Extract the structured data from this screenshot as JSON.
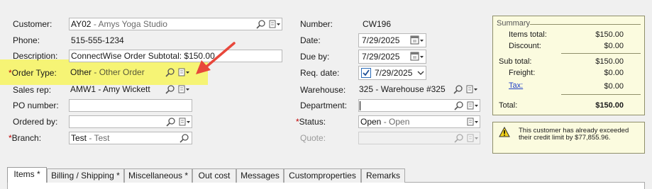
{
  "left": {
    "customer": {
      "label": "Customer:",
      "code": "AY02",
      "desc": "- Amys Yoga Studio"
    },
    "phone": {
      "label": "Phone:",
      "value": "515-555-1234"
    },
    "description": {
      "label": "Description:",
      "value": "ConnectWise Order Subtotal: $150.00"
    },
    "order_type": {
      "required": "*",
      "label": "Order Type:",
      "code": "Other",
      "desc": "- Other Order"
    },
    "sales_rep": {
      "label": "Sales rep:",
      "code": "AMW1",
      "desc": "- Amy Wickett"
    },
    "po_number": {
      "label": "PO number:",
      "value": ""
    },
    "ordered_by": {
      "label": "Ordered by:",
      "value": ""
    },
    "branch": {
      "required": "*",
      "label": "Branch:",
      "code": "Test",
      "desc": "- Test"
    }
  },
  "middle": {
    "number": {
      "label": "Number:",
      "value": "CW196"
    },
    "date": {
      "label": "Date:",
      "value": "7/29/2025"
    },
    "due_by": {
      "label": "Due by:",
      "value": "7/29/2025"
    },
    "req_date": {
      "label": "Req. date:",
      "value": "7/29/2025",
      "checked": true
    },
    "warehouse": {
      "label": "Warehouse:",
      "code": "325",
      "desc": "- Warehouse #325"
    },
    "department": {
      "label": "Department:",
      "value": ""
    },
    "status": {
      "required": "*",
      "label": "Status:",
      "code": "Open",
      "desc": "- Open"
    },
    "quote": {
      "label": "Quote:",
      "value": ""
    }
  },
  "summary": {
    "title": "Summary",
    "items_total": {
      "label": "Items total:",
      "value": "$150.00"
    },
    "discount": {
      "label": "Discount:",
      "value": "$0.00"
    },
    "sub_total": {
      "label": "Sub total:",
      "value": "$150.00"
    },
    "freight": {
      "label": "Freight:",
      "value": "$0.00"
    },
    "tax": {
      "label": "Tax:",
      "value": "$0.00"
    },
    "total": {
      "label": "Total:",
      "value": "$150.00"
    }
  },
  "warning": {
    "message": "This customer has already exceeded their credit limit by $77,855.96."
  },
  "tabs": [
    {
      "label": "Items *"
    },
    {
      "label": "Billing / Shipping  *"
    },
    {
      "label": "Miscellaneous *"
    },
    {
      "label": "Out cost"
    },
    {
      "label": "Messages"
    },
    {
      "label": "Customproperties"
    },
    {
      "label": "Remarks"
    }
  ],
  "colors": {
    "highlight": "#f6f467",
    "arrow": "#e8473b",
    "link": "#1f3fc9",
    "required": "#c00000"
  },
  "icons": [
    "search-icon",
    "note-dropdown-icon",
    "calendar-icon",
    "chevron-down-icon",
    "checkbox-checked-icon",
    "warning-icon",
    "red-arrow-annotation"
  ]
}
